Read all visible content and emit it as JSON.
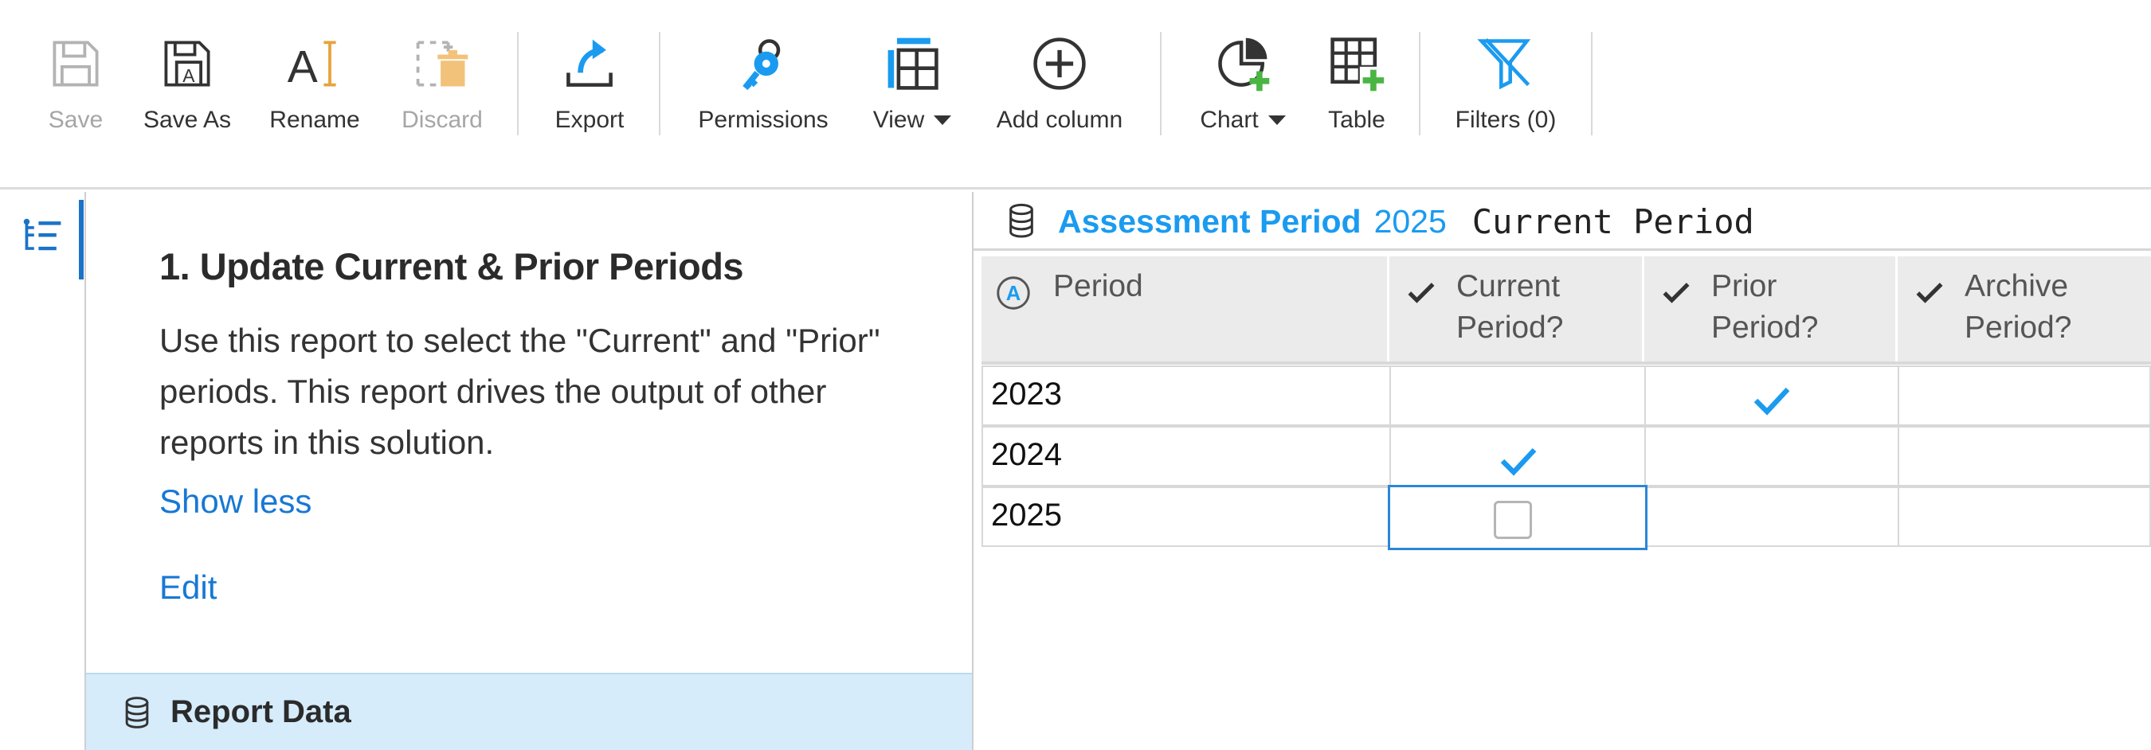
{
  "toolbar": {
    "buttons": {
      "save": {
        "label": "Save",
        "icon": "save-icon",
        "enabled": false
      },
      "save_as": {
        "label": "Save As",
        "icon": "save-as-icon",
        "enabled": true
      },
      "rename": {
        "label": "Rename",
        "icon": "rename-icon",
        "enabled": true
      },
      "discard": {
        "label": "Discard",
        "icon": "discard-icon",
        "enabled": false
      },
      "export": {
        "label": "Export",
        "icon": "export-icon",
        "enabled": true
      },
      "permissions": {
        "label": "Permissions",
        "icon": "key-icon",
        "enabled": true
      },
      "view": {
        "label": "View",
        "icon": "grid-view-icon",
        "enabled": true
      },
      "add_column": {
        "label": "Add column",
        "icon": "plus-circle-icon",
        "enabled": true
      },
      "chart": {
        "label": "Chart",
        "icon": "pie-chart-add-icon",
        "enabled": true
      },
      "table": {
        "label": "Table",
        "icon": "table-add-icon",
        "enabled": true
      },
      "filters": {
        "label": "Filters (0)",
        "icon": "filter-icon",
        "enabled": true
      }
    },
    "colors": {
      "accent": "#1a9bf0",
      "add_badge": "#4bb543",
      "disabled": "#a6a6a6",
      "discard_icon": "#f3c27a"
    }
  },
  "rail": {
    "icon": "outline-list-icon"
  },
  "panel": {
    "title": "1. Update Current & Prior Periods",
    "description": "Use this report to select the \"Current\" and \"Prior\" periods. This report drives the output of other reports in this solution.",
    "show_less": "Show less",
    "edit": "Edit",
    "report_data": {
      "label": "Report Data",
      "icon": "database-icon"
    }
  },
  "view": {
    "title_name": "Assessment Period",
    "title_year": "2025",
    "title_filter": "Current Period",
    "title_icon": "database-icon",
    "columns": [
      {
        "label": "Period",
        "icon": "attribute-a-icon"
      },
      {
        "label": "Current Period?",
        "icon": "checkmark-icon"
      },
      {
        "label": "Prior Period?",
        "icon": "checkmark-icon"
      },
      {
        "label": "Archive Period?",
        "icon": "checkmark-icon"
      }
    ],
    "rows": [
      {
        "period": "2023",
        "current": false,
        "prior": true,
        "archive": false
      },
      {
        "period": "2024",
        "current": true,
        "prior": false,
        "archive": false
      },
      {
        "period": "2025",
        "current": false,
        "prior": false,
        "archive": false,
        "editing": "current"
      }
    ],
    "colors": {
      "check": "#1a9bf0",
      "selection": "#2b86d9",
      "header_bg": "#ebebeb"
    }
  }
}
